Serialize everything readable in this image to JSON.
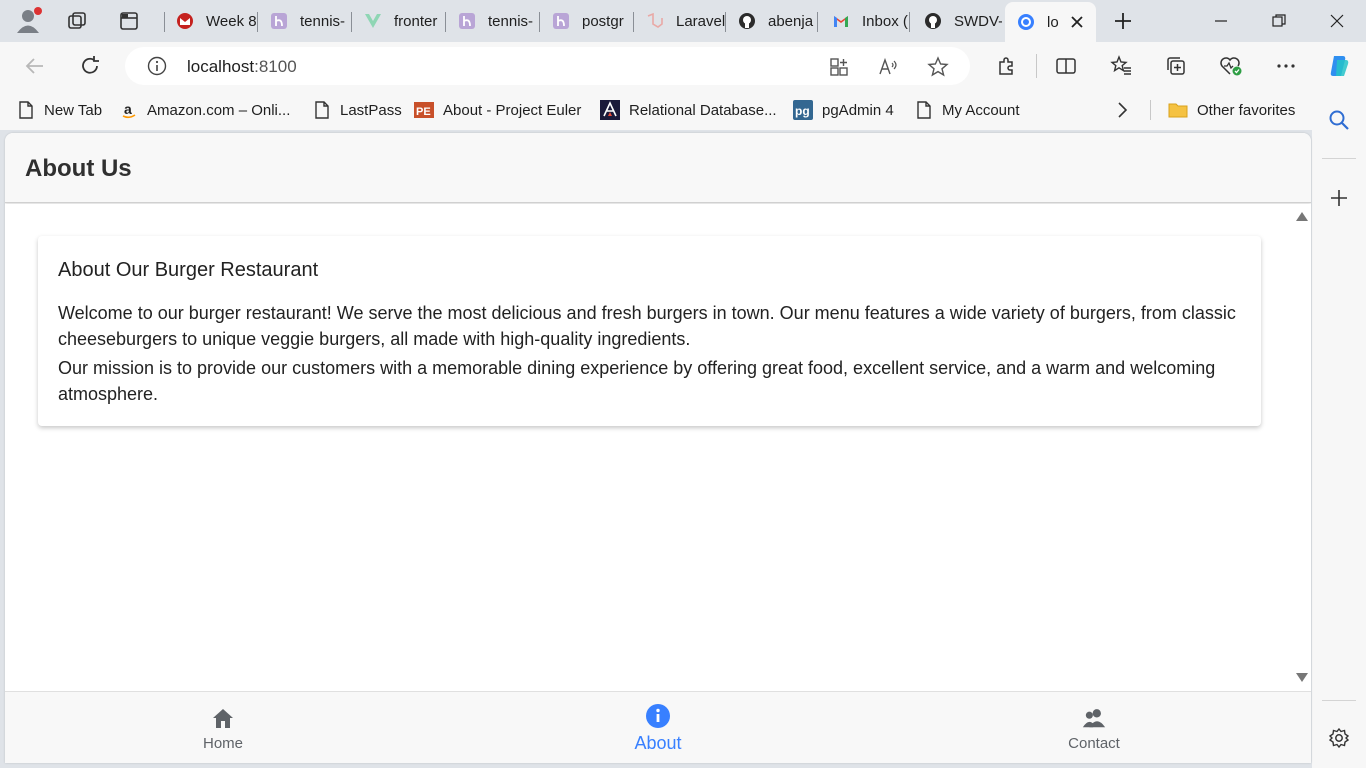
{
  "browser": {
    "tabs": [
      {
        "title": "Week 8",
        "icon": "gmail-red-icon"
      },
      {
        "title": "tennis-",
        "icon": "heroku-icon"
      },
      {
        "title": "fronter",
        "icon": "vue-icon"
      },
      {
        "title": "tennis-",
        "icon": "heroku-icon"
      },
      {
        "title": "postgr",
        "icon": "heroku-icon"
      },
      {
        "title": "Laravel",
        "icon": "laravel-icon"
      },
      {
        "title": "abenja",
        "icon": "github-icon"
      },
      {
        "title": "Inbox (",
        "icon": "gmail-icon"
      },
      {
        "title": "SWDV-",
        "icon": "github-icon"
      },
      {
        "title": "lo",
        "icon": "ionic-icon"
      }
    ],
    "address": {
      "host": "localhost",
      "port": ":8100"
    },
    "bookmarks": [
      {
        "label": "New Tab",
        "icon": "page-icon"
      },
      {
        "label": "Amazon.com – Onli...",
        "icon": "amazon-icon"
      },
      {
        "label": "LastPass",
        "icon": "page-icon"
      },
      {
        "label": "About - Project Euler",
        "icon": "project-euler-icon"
      },
      {
        "label": "Relational Database...",
        "icon": "database-icon"
      },
      {
        "label": "pgAdmin 4",
        "icon": "pgadmin-icon"
      },
      {
        "label": "My Account",
        "icon": "page-icon"
      }
    ],
    "other_favorites": "Other favorites",
    "accent": "#3880ff"
  },
  "app": {
    "header_title": "About Us",
    "card": {
      "title": "About Our Burger Restaurant",
      "paragraph1": "Welcome to our burger restaurant! We serve the most delicious and fresh burgers in town. Our menu features a wide variety of burgers, from classic cheeseburgers to unique veggie burgers, all made with high-quality ingredients.",
      "paragraph2": "Our mission is to provide our customers with a memorable dining experience by offering great food, excellent service, and a warm and welcoming atmosphere."
    },
    "tabs": [
      {
        "label": "Home",
        "icon": "home-icon"
      },
      {
        "label": "About",
        "icon": "info-icon",
        "selected": true
      },
      {
        "label": "Contact",
        "icon": "people-icon"
      }
    ]
  }
}
